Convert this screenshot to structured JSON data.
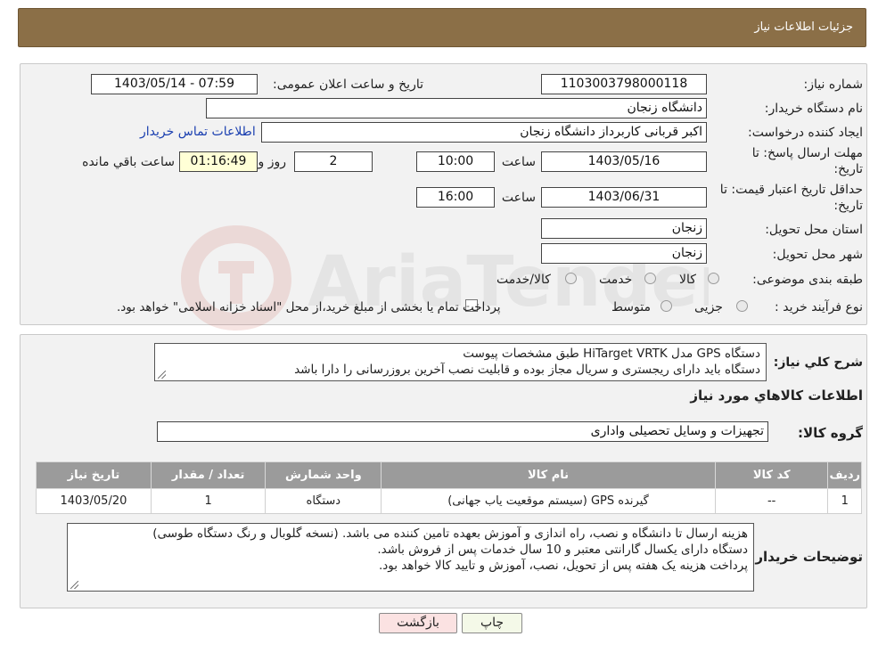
{
  "header": {
    "title": "جزئیات اطلاعات نیاز"
  },
  "form": {
    "need_number_label": "شماره نیاز:",
    "need_number": "1103003798000118",
    "announce_label": "تاریخ و ساعت اعلان عمومی:",
    "announce_value": "1403/05/14 - 07:59",
    "buyer_org_label": "نام دستگاه خریدار:",
    "buyer_org": "دانشگاه زنجان",
    "creator_label": "ایجاد کننده درخواست:",
    "creator": "اکبر قربانی کاربرداز دانشگاه زنجان",
    "contact_link": "اطلاعات تماس خریدار",
    "deadline_label_line1": "مهلت ارسال پاسخ: تا",
    "deadline_label_line2": "تاریخ:",
    "deadline_date": "1403/05/16",
    "time_label": "ساعت",
    "deadline_time": "10:00",
    "days_value": "2",
    "days_label": "روز و",
    "remaining_time": "01:16:49",
    "remaining_label": "ساعت باقي مانده",
    "validity_label_line1": "حداقل تاریخ اعتبار قیمت: تا",
    "validity_label_line2": "تاریخ:",
    "validity_date": "1403/06/31",
    "validity_time": "16:00",
    "province_label": "استان محل تحویل:",
    "province": "زنجان",
    "city_label": "شهر محل تحویل:",
    "city": "زنجان",
    "category_label": "طبقه بندی موضوعی:",
    "category_options": [
      "کالا",
      "خدمت",
      "کالا/خدمت"
    ],
    "process_label": "نوع فرآیند خرید :",
    "process_options": [
      "جزیی",
      "متوسط"
    ],
    "process_note": "پرداخت تمام یا بخشی از مبلغ خرید،از محل \"اسناد خزانه اسلامی\" خواهد بود."
  },
  "description": {
    "label": "شرح کلي نياز:",
    "lines": [
      "دستگاه GPS مدل HiTarget VRTK طبق مشخصات پیوست",
      "دستگاه باید دارای ریجستری و سریال مجاز بوده و قابلیت نصب آخرین بروزرسانی را دارا باشد"
    ]
  },
  "goods": {
    "section_title": "اطلاعات کالاهاي مورد نياز",
    "group_label": "گروه کالا:",
    "group_value": "تجهیزات و وسایل تحصیلی واداری",
    "columns": [
      "رديف",
      "کد کالا",
      "نام کالا",
      "واحد شمارش",
      "تعداد / مقدار",
      "تاریخ نیاز"
    ],
    "rows": [
      [
        "1",
        "--",
        "گیرنده GPS (سیستم موقعیت یاب جهانی)",
        "دستگاه",
        "1",
        "1403/05/20"
      ]
    ]
  },
  "buyer_notes": {
    "label": "توضیحات خریدار:",
    "lines": [
      "هزینه ارسال تا دانشگاه و نصب، راه اندازی و آموزش بعهده تامین کننده می باشد. (نسخه گلوبال و رنگ دستگاه طوسی)",
      "دستگاه دارای یکسال گارانتی معتبر و 10 سال خدمات پس از فروش باشد.",
      "پرداخت هزینه یک هفته پس از تحویل، نصب، آموزش و تایید کالا خواهد بود."
    ]
  },
  "buttons": {
    "print": "چاپ",
    "back": "بازگشت"
  },
  "watermark": {
    "text": "AriaTender.neT"
  }
}
